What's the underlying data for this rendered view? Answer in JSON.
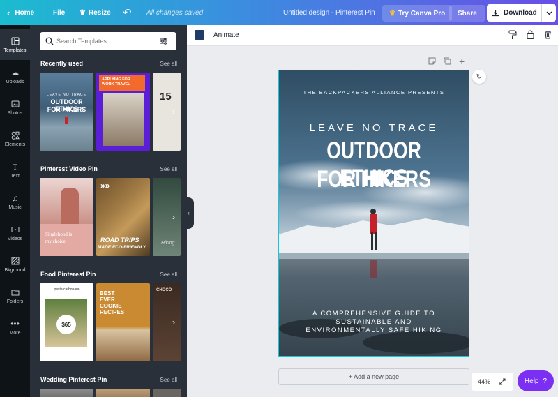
{
  "topbar": {
    "home_label": "Home",
    "file_label": "File",
    "resize_label": "Resize",
    "saved_status": "All changes saved",
    "design_title": "Untitled design - Pinterest Pin",
    "try_pro_label": "Try Canva Pro",
    "share_label": "Share",
    "download_label": "Download"
  },
  "rail": {
    "items": [
      {
        "label": "Templates",
        "icon": "templates-icon"
      },
      {
        "label": "Uploads",
        "icon": "upload-icon"
      },
      {
        "label": "Photos",
        "icon": "photo-icon"
      },
      {
        "label": "Elements",
        "icon": "elements-icon"
      },
      {
        "label": "Text",
        "icon": "text-icon"
      },
      {
        "label": "Music",
        "icon": "music-icon"
      },
      {
        "label": "Videos",
        "icon": "video-icon"
      },
      {
        "label": "Bkground",
        "icon": "background-icon"
      },
      {
        "label": "Folders",
        "icon": "folder-icon"
      },
      {
        "label": "More",
        "icon": "more-icon"
      }
    ]
  },
  "panel": {
    "search_placeholder": "Search Templates",
    "see_all": "See all",
    "sections": [
      {
        "title": "Recently used",
        "thumbs": [
          {
            "lines": [
              "LEAVE NO TRACE",
              "OUTDOOR ETHICS",
              "FOR HIKERS"
            ]
          },
          {
            "lines": [
              "APPLYING FOR",
              "WORK TRAVEL"
            ]
          },
          {
            "lines": [
              "15"
            ]
          }
        ]
      },
      {
        "title": "Pinterest Video Pin",
        "thumbs": [
          {
            "lines": [
              "Singlehood is",
              "my choice"
            ]
          },
          {
            "lines": [
              "ROAD TRIPS",
              "MADE ECO-FRIENDLY"
            ]
          },
          {
            "lines": [
              "Hiking"
            ]
          }
        ]
      },
      {
        "title": "Food Pinterest Pin",
        "thumbs": [
          {
            "lines": [
              "pasta carbonara",
              "$65"
            ]
          },
          {
            "lines": [
              "BEST",
              "EVER",
              "COOKIE",
              "RECIPES"
            ]
          },
          {
            "lines": [
              "CHOCO"
            ]
          }
        ]
      },
      {
        "title": "Wedding Pinterest Pin",
        "thumbs": []
      }
    ]
  },
  "canvas": {
    "animate_label": "Animate",
    "swatch_color": "#1f3b68",
    "design": {
      "org": "THE BACKPACKERS ALLIANCE PRESENTS",
      "subtitle": "LEAVE NO TRACE",
      "title_line1": "OUTDOOR ETHICS",
      "title_line2": "FOR HIKERS",
      "bottom_line1": "A COMPREHENSIVE GUIDE TO",
      "bottom_line2": "SUSTAINABLE AND",
      "bottom_line3": "ENVIRONMENTALLY SAFE HIKING"
    },
    "add_page_label": "+ Add a new page",
    "zoom_label": "44%",
    "help_label": "Help",
    "help_icon_char": "?"
  }
}
